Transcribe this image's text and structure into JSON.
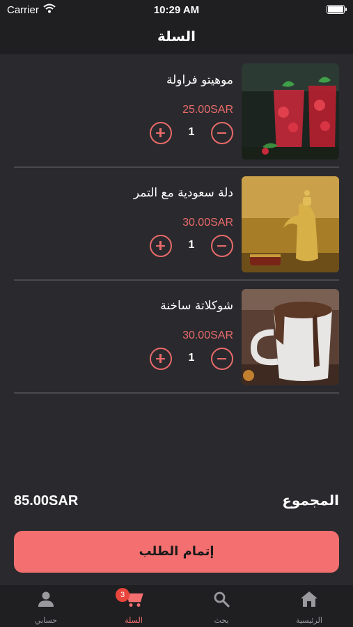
{
  "status_bar": {
    "carrier": "Carrier",
    "time": "10:29 AM"
  },
  "header": {
    "title": "السلة"
  },
  "cart": {
    "items": [
      {
        "name": "موهيتو فراولة",
        "price": "25.00SAR",
        "quantity": "1",
        "image": "strawberry-mojito-photo"
      },
      {
        "name": "دلة  سعودية مع التمر",
        "price": "30.00SAR",
        "quantity": "1",
        "image": "saudi-coffee-dallah-photo"
      },
      {
        "name": "شوكلاتة ساخنة",
        "price": "30.00SAR",
        "quantity": "1",
        "image": "hot-chocolate-photo"
      }
    ]
  },
  "total": {
    "label": "المجموع",
    "amount": "85.00SAR"
  },
  "checkout_button": {
    "label": "إتمام الطلب"
  },
  "tab_bar": {
    "home": "الرئيسية",
    "search": "بحث",
    "cart": "السلة",
    "cart_badge": "3",
    "account": "حسابي",
    "active": "cart"
  },
  "colors": {
    "accent": "#f46f6f",
    "price": "#ea6a6a",
    "background": "#2a2a2e",
    "bar": "#1f1f22",
    "badge": "#e8453c"
  }
}
